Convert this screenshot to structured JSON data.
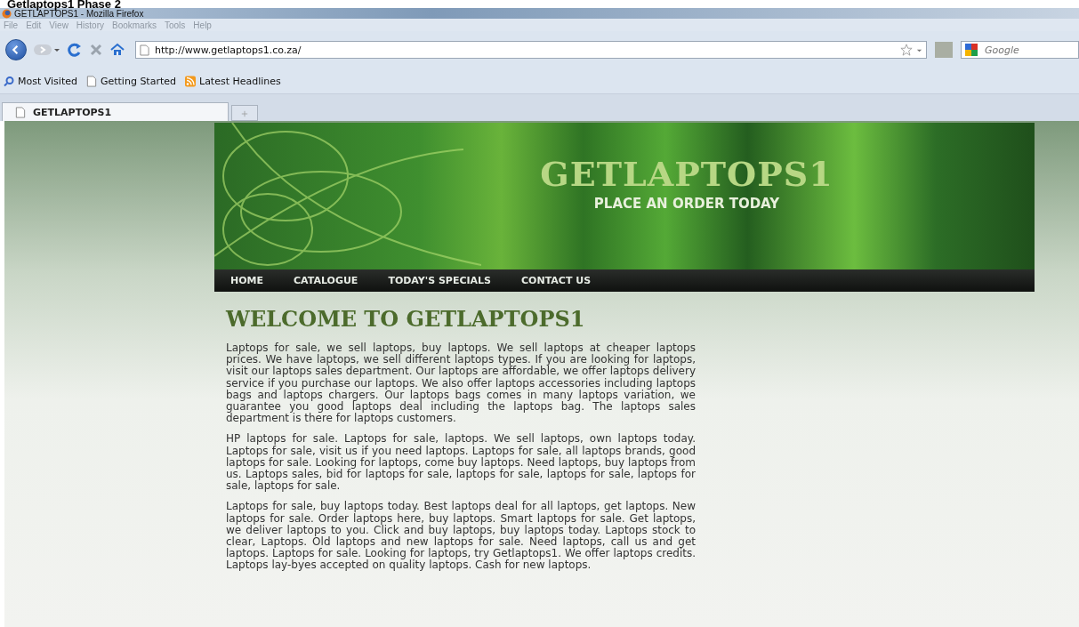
{
  "caption": "Getlaptops1 Phase 2",
  "window": {
    "title": "GETLAPTOPS1 - Mozilla Firefox"
  },
  "menu": [
    "File",
    "Edit",
    "View",
    "History",
    "Bookmarks",
    "Tools",
    "Help"
  ],
  "address": {
    "value": "http://www.getlaptops1.co.za/"
  },
  "search": {
    "placeholder": "Google"
  },
  "bookmarks": [
    {
      "label": "Most Visited",
      "kind": "search"
    },
    {
      "label": "Getting Started",
      "kind": "page"
    },
    {
      "label": "Latest Headlines",
      "kind": "feed"
    }
  ],
  "tabs": [
    {
      "label": "GETLAPTOPS1",
      "selected": true
    }
  ],
  "site": {
    "title": "GETLAPTOPS1",
    "tagline": "PLACE AN ORDER TODAY",
    "nav": [
      "HOME",
      "CATALOGUE",
      "TODAY'S SPECIALS",
      "CONTACT US"
    ],
    "heading": "WELCOME TO GETLAPTOPS1",
    "paragraphs": [
      "Laptops for sale, we sell laptops, buy laptops. We sell laptops at cheaper laptops prices. We have laptops, we sell different laptops types. If you are looking for laptops, visit our laptops sales department. Our laptops are affordable, we offer laptops delivery service if you purchase our laptops. We also offer laptops accessories including laptops bags and laptops chargers. Our laptops bags comes in many laptops variation, we guarantee you good laptops deal including the laptops bag. The laptops sales department is there for laptops customers.",
      "HP laptops for sale. Laptops for sale, laptops. We sell laptops, own laptops today. Laptops for sale, visit us if you need laptops. Laptops for sale, all laptops brands, good laptops for sale. Looking for laptops, come buy laptops. Need laptops, buy laptops from us. Laptops sales, bid for laptops for sale, laptops for sale, laptops for sale, laptops for sale, laptops for sale.",
      "Laptops for sale, buy laptops today. Best laptops deal for all laptops, get laptops. New laptops for sale. Order laptops here, buy laptops. Smart laptops for sale. Get laptops, we deliver laptops to you. Click and buy laptops, buy laptops today. Laptops stock to clear, Laptops. Old laptops and new laptops for sale. Need laptops, call us and get laptops. Laptops for sale. Looking for laptops, try Getlaptops1. We offer laptops credits. Laptops lay-byes accepted on quality laptops. Cash for new laptops."
    ]
  }
}
